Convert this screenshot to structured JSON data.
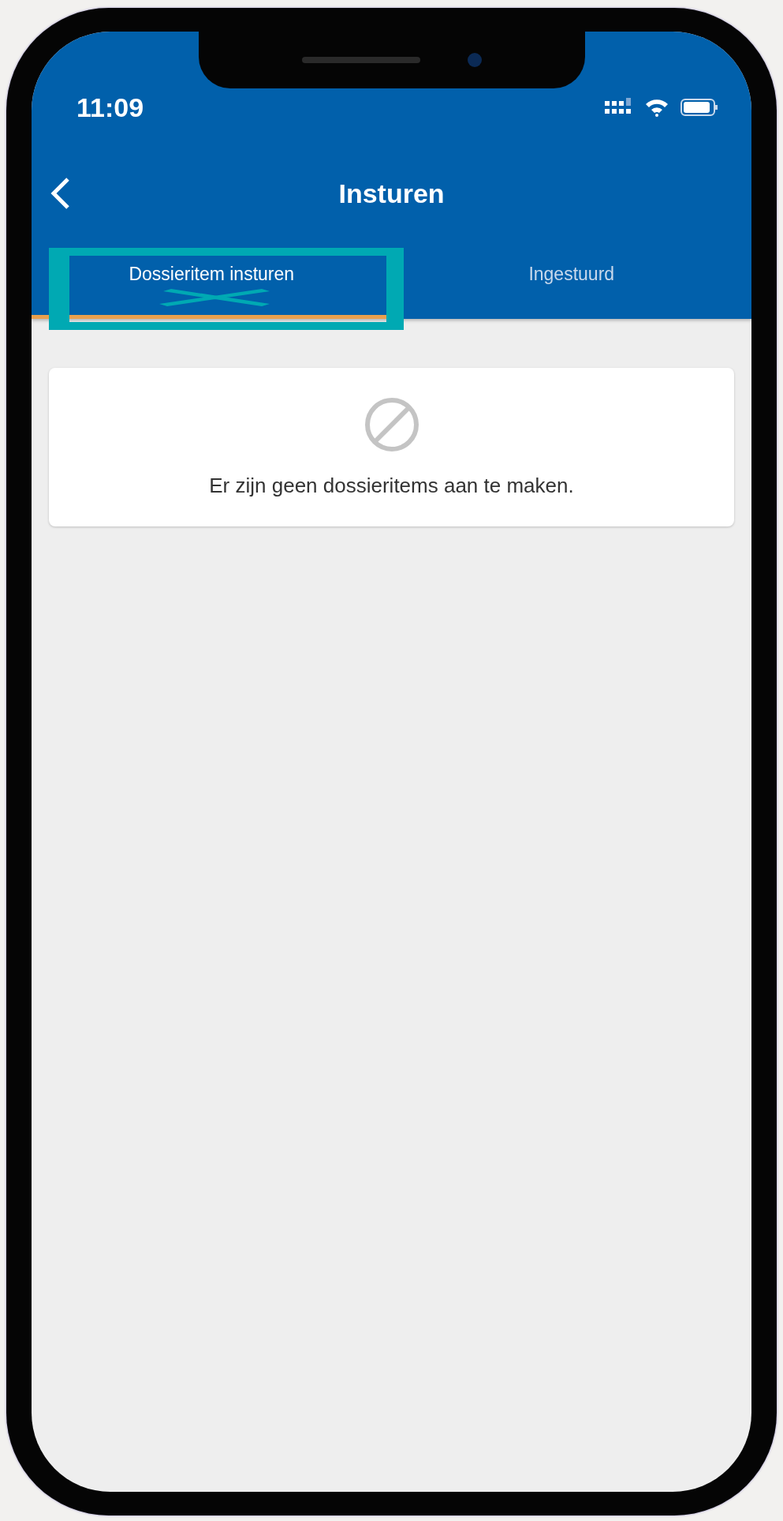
{
  "status_bar": {
    "time": "11:09"
  },
  "header": {
    "title": "Insturen"
  },
  "tabs": [
    {
      "label": "Dossieritem insturen",
      "selected": true,
      "highlighted": true
    },
    {
      "label": "Ingestuurd",
      "selected": false,
      "highlighted": false
    }
  ],
  "empty_state": {
    "message": "Er zijn geen dossieritems aan te maken."
  }
}
